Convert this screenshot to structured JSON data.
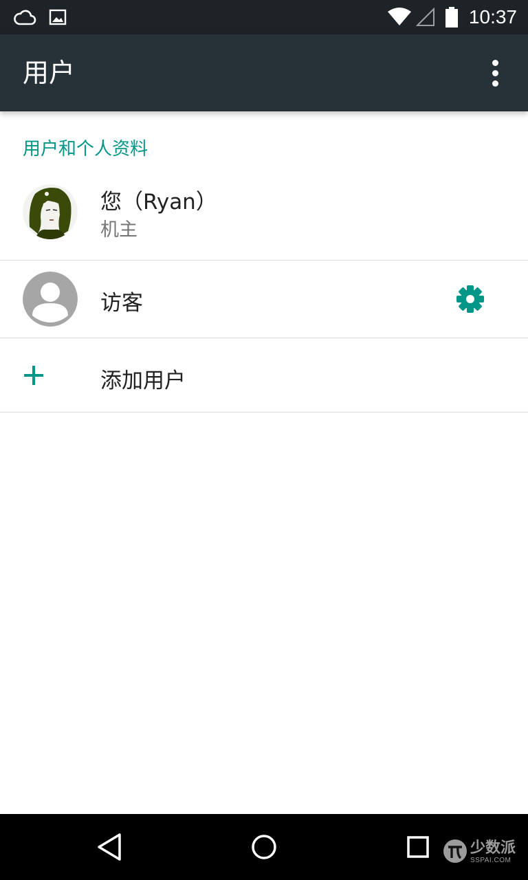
{
  "status_bar": {
    "time": "10:37",
    "icons": [
      "cloud-icon",
      "image-notification-icon",
      "wifi-icon",
      "signal-icon",
      "battery-icon"
    ]
  },
  "app_bar": {
    "title": "用户",
    "overflow_icon": "more-vert-icon"
  },
  "section": {
    "header": "用户和个人资料"
  },
  "users": [
    {
      "name": "您（Ryan）",
      "subtitle": "机主",
      "avatar": "user-photo-avatar"
    },
    {
      "name": "访客",
      "avatar": "default-person-avatar",
      "action_icon": "gear-icon"
    }
  ],
  "add_user": {
    "label": "添加用户",
    "icon": "plus-icon"
  },
  "nav_bar": {
    "buttons": [
      "back-icon",
      "home-icon",
      "recents-icon"
    ]
  },
  "watermark": {
    "text": "少数派",
    "domain": "SSPAI.COM"
  },
  "colors": {
    "status_bar": "#1d2327",
    "app_bar": "#263238",
    "accent": "#009688",
    "nav_bar": "#000000",
    "divider": "#dcdcdc"
  }
}
